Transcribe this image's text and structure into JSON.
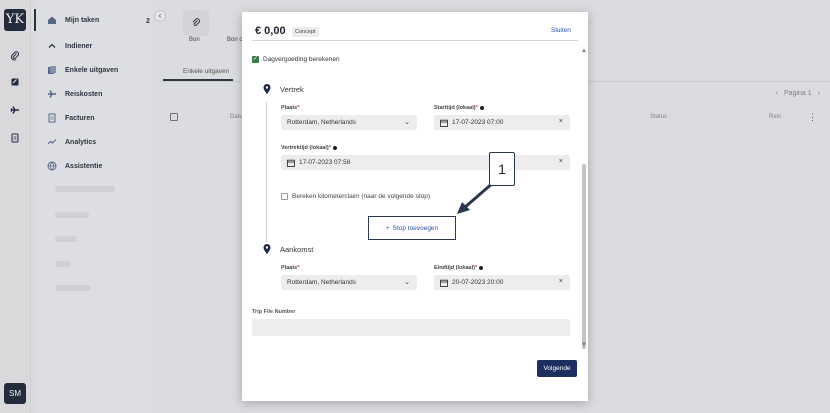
{
  "rail": {
    "logo": "YK",
    "avatar": "SM",
    "icons": [
      "paperclip-icon",
      "receipt-icon",
      "plane-icon",
      "document-icon"
    ]
  },
  "sidebar": {
    "my_tasks": "Mijn taken",
    "my_tasks_count": "2",
    "section": "Indiener",
    "items": [
      {
        "label": "Enkele uitgaven",
        "icon": "receipt-stack-icon"
      },
      {
        "label": "Reiskosten",
        "icon": "plane-icon"
      },
      {
        "label": "Facturen",
        "icon": "invoice-icon"
      },
      {
        "label": "Analytics",
        "icon": "chart-line-icon"
      },
      {
        "label": "Assistentie",
        "icon": "globe-icon"
      }
    ]
  },
  "background": {
    "cards": [
      "Bon",
      "Bon o"
    ],
    "tab": "Enkele uitgaven",
    "pager": "Pagina 1",
    "columns": [
      "Datu",
      "Status",
      "Reis"
    ]
  },
  "modal": {
    "amount": "€ 0,00",
    "status_badge": "Concept",
    "close": "Sluiten",
    "allowance_label": "Dagvergoeding berekenen",
    "departure": {
      "title": "Vertrek",
      "place_label": "Plaats",
      "place_value": "Rotterdam, Netherlands",
      "start_label": "Starttijd (lokaal)",
      "start_value": "17-07-2023 07:00",
      "depart_label": "Vertrektijd (lokaal)",
      "depart_value": "17-07-2023 07:58"
    },
    "km_label": "Bereken kilometerclaim (naar de volgende stop)",
    "add_stop": "Stop toevoegen",
    "arrival": {
      "title": "Aankomst",
      "place_label": "Plaats",
      "place_value": "Rotterdam, Netherlands",
      "end_label": "Eindtijd (lokaal)",
      "end_value": "20-07-2023 20:00"
    },
    "trip_label": "Trip File Number",
    "trip_value": "",
    "next": "Volgende"
  },
  "callout": {
    "number": "1"
  },
  "colors": {
    "primary": "#1d2f5e",
    "link": "#2b4fa8",
    "check": "#3c7a4a"
  }
}
